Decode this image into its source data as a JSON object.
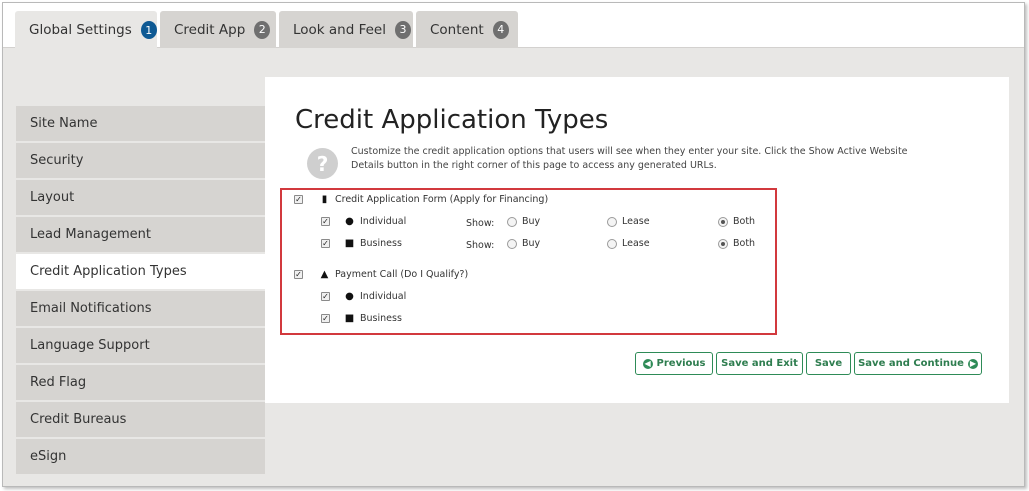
{
  "tabs": [
    {
      "label": "Global Settings",
      "badge": "1"
    },
    {
      "label": "Credit App",
      "badge": "2"
    },
    {
      "label": "Look and Feel",
      "badge": "3"
    },
    {
      "label": "Content",
      "badge": "4"
    }
  ],
  "sidebar": {
    "items": [
      {
        "label": "Site Name"
      },
      {
        "label": "Security"
      },
      {
        "label": "Layout"
      },
      {
        "label": "Lead Management"
      },
      {
        "label": "Credit Application Types"
      },
      {
        "label": "Email Notifications"
      },
      {
        "label": "Language Support"
      },
      {
        "label": "Red Flag"
      },
      {
        "label": "Credit Bureaus"
      },
      {
        "label": "eSign"
      }
    ]
  },
  "main": {
    "title": "Credit Application Types",
    "help_text": "Customize the credit application options that users will see when they enter your site. Click the Show Active Website Details button in the right corner of this page to access any generated URLs.",
    "form_app": {
      "label": "Credit Application Form (Apply for Financing)",
      "checked": true,
      "rows": [
        {
          "label": "Individual",
          "checked": true,
          "show_label": "Show:",
          "options": [
            "Buy",
            "Lease",
            "Both"
          ],
          "selected": "Both"
        },
        {
          "label": "Business",
          "checked": true,
          "show_label": "Show:",
          "options": [
            "Buy",
            "Lease",
            "Both"
          ],
          "selected": "Both"
        }
      ]
    },
    "payment_call": {
      "label": "Payment Call (Do I Qualify?)",
      "checked": true,
      "rows": [
        {
          "label": "Individual",
          "checked": true
        },
        {
          "label": "Business",
          "checked": true
        }
      ]
    }
  },
  "buttons": {
    "previous": "Previous",
    "save_exit": "Save and Exit",
    "save": "Save",
    "save_continue": "Save and Continue"
  },
  "icons": {
    "help": "question-icon",
    "document": "document-icon",
    "person": "person-icon",
    "briefcase": "briefcase-icon",
    "road": "road-icon"
  },
  "colors": {
    "active_badge": "#0f5a94",
    "highlight_border": "#d2393d",
    "button_green": "#2e8b57"
  }
}
